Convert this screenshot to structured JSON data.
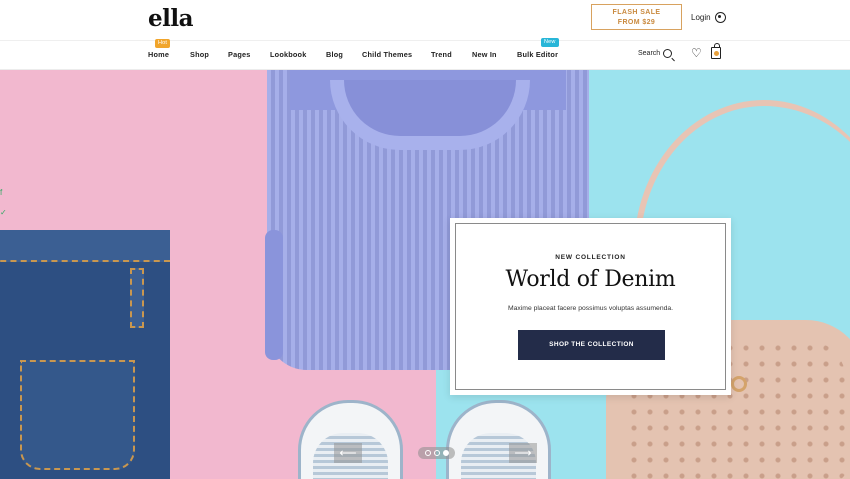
{
  "header": {
    "logo": "ella",
    "flash_sale": {
      "line1": "FLASH SALE",
      "line2": "FROM $29"
    },
    "login_label": "Login"
  },
  "nav": {
    "items": [
      {
        "label": "Home",
        "badge": "Hot"
      },
      {
        "label": "Shop"
      },
      {
        "label": "Pages"
      },
      {
        "label": "Lookbook"
      },
      {
        "label": "Blog"
      },
      {
        "label": "Child Themes"
      },
      {
        "label": "Trend"
      },
      {
        "label": "New In"
      },
      {
        "label": "Bulk Editor",
        "badge": "New"
      }
    ],
    "search_label": "Search"
  },
  "hero": {
    "eyebrow": "NEW COLLECTION",
    "title": "World of Denim",
    "description": "Maxime placeat facere possimus voluptas assumenda.",
    "cta_label": "SHOP THE COLLECTION",
    "prev_arrow": "⟵",
    "next_arrow": "⟶",
    "slides_total": 3,
    "active_slide": 3
  },
  "colors": {
    "accent": "#c98a3f",
    "cta_bg": "#232c49",
    "hot_badge": "#f1a52b",
    "new_badge": "#28b6d8",
    "hero_left": "#f2b8cf",
    "hero_right": "#9ce3ee"
  }
}
